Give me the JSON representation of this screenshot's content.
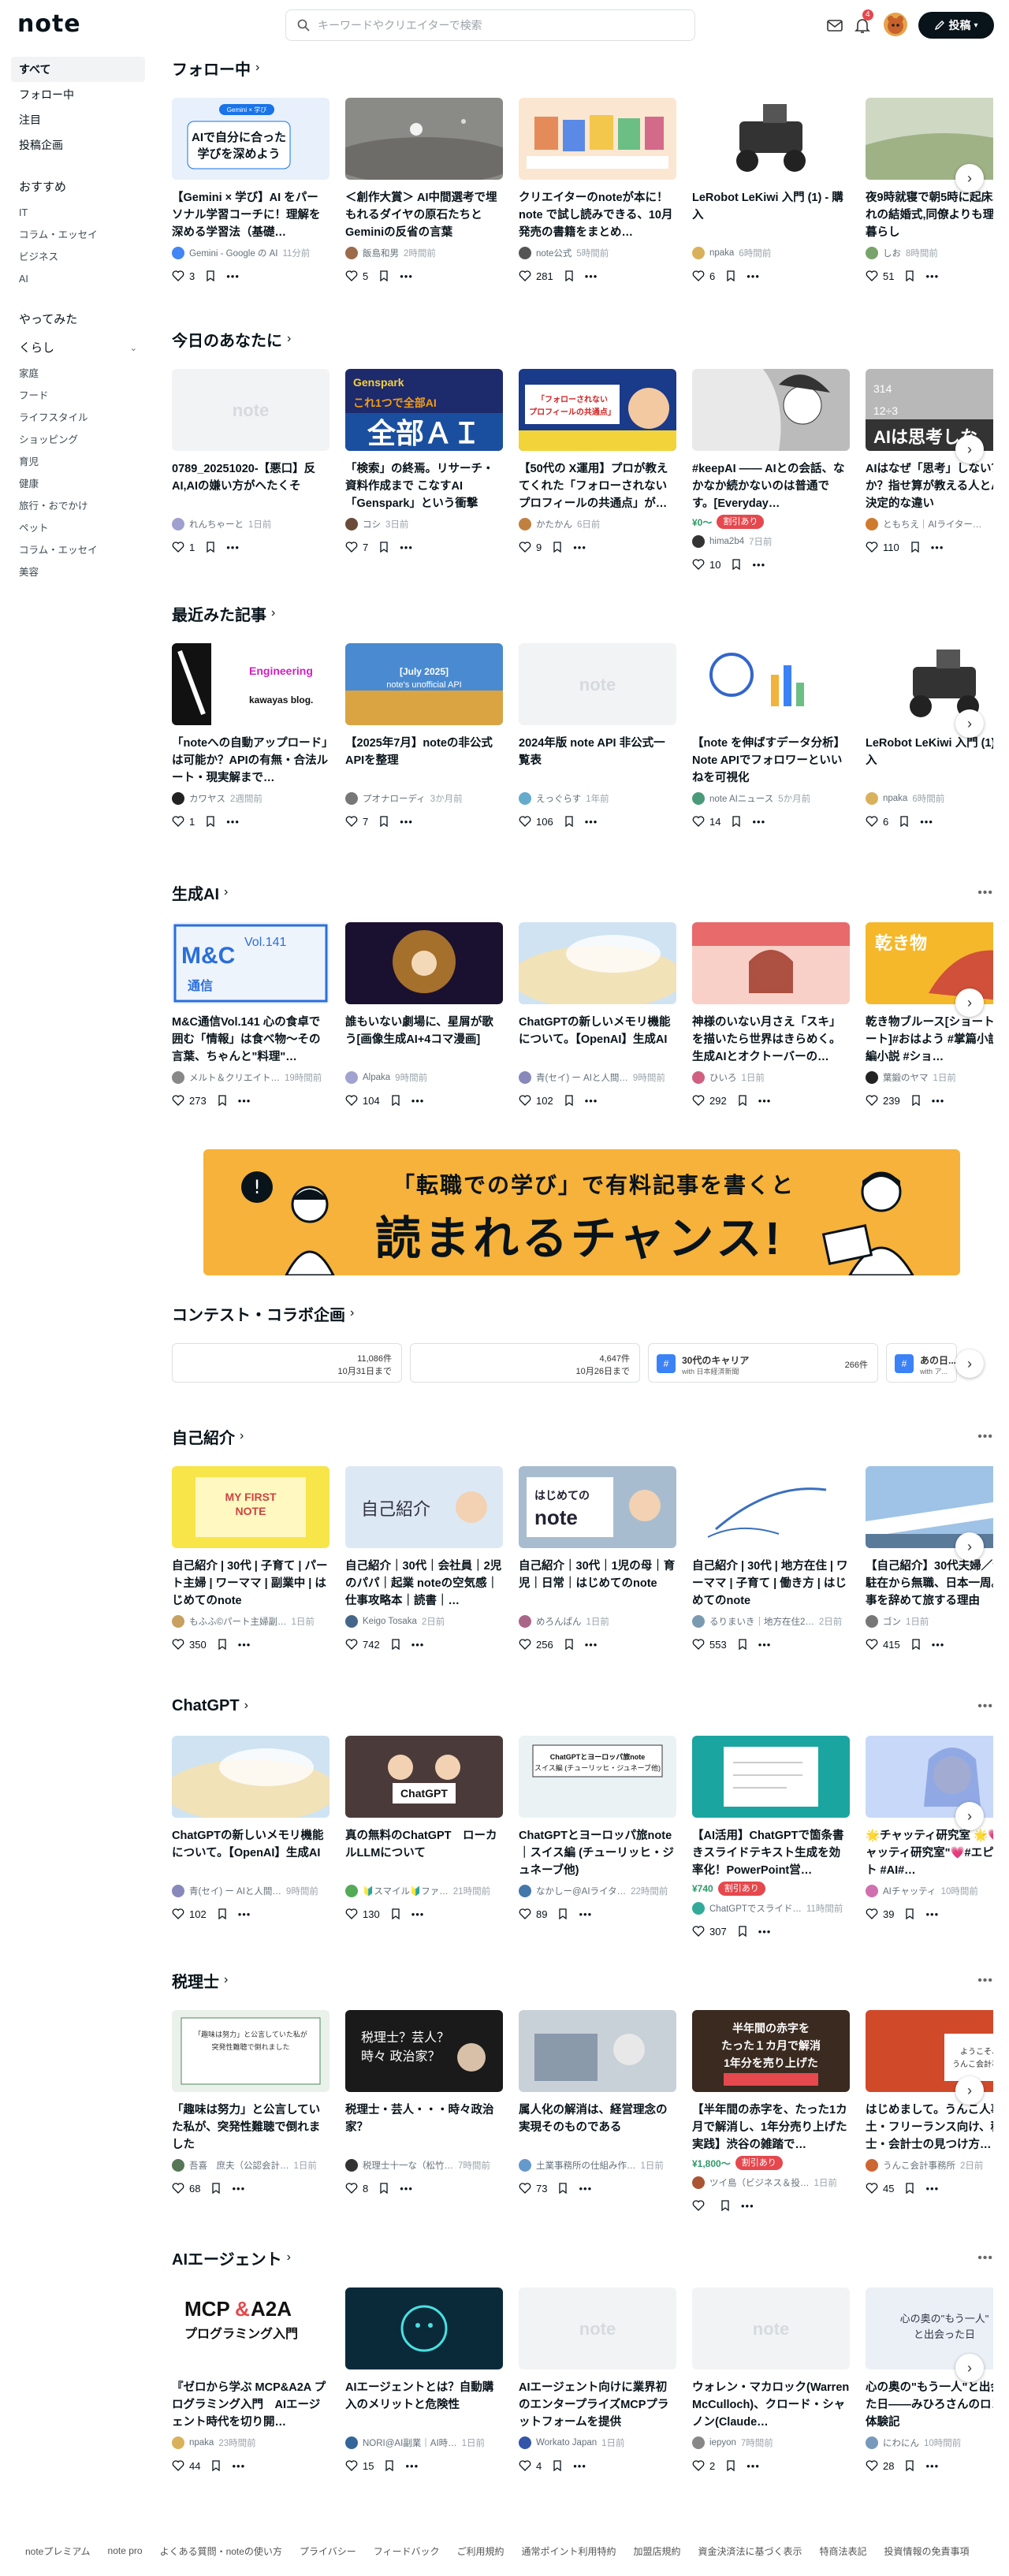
{
  "header": {
    "logo": "note",
    "search_placeholder": "キーワードやクリエイターで検索",
    "notification_count": "4",
    "post_label": "投稿"
  },
  "sidebar": {
    "top": [
      "すべて",
      "フォロー中",
      "注目",
      "投稿企画"
    ],
    "mid": [
      "おすすめ",
      "IT",
      "コラム・エッセイ",
      "ビジネス",
      "AI"
    ],
    "group1": "やってみた",
    "group2": "くらし",
    "kurashi": [
      "家庭",
      "フード",
      "ライフスタイル",
      "ショッピング",
      "育児",
      "健康",
      "旅行・おでかけ",
      "ペット",
      "コラム・エッセイ",
      "美容"
    ]
  },
  "sections": [
    {
      "title": "フォロー中",
      "cards": [
        {
          "title": "【Gemini × 学び】AI をパーソナル学習コーチに！理解を深める学習法（基礎…",
          "author": "Gemini - Google の AI",
          "time": "11分前",
          "likes": "3",
          "thumb": "gemini",
          "av": "#4285f4"
        },
        {
          "title": "＜創作大賞＞ AI中間選考で埋もれるダイヤの原石たちとGeminiの反省の言葉",
          "author": "飯島和男",
          "time": "2時間前",
          "likes": "5",
          "thumb": "stone",
          "av": "#9b6b4a"
        },
        {
          "title": "クリエイターのnoteが本に！note で試し読みできる、10月発売の書籍をまとめ…",
          "author": "note公式",
          "time": "5時間前",
          "likes": "281",
          "thumb": "books",
          "av": "#555"
        },
        {
          "title": "LeRobot LeKiwi 入門 (1) - 購入",
          "author": "npaka",
          "time": "6時間前",
          "likes": "6",
          "thumb": "robot",
          "av": "#d9b15b"
        },
        {
          "title": "夜9時就寝で朝5時に起床。憧れの結婚式,同僚よりも理想の暮らし",
          "author": "しお",
          "time": "8時間前",
          "likes": "51",
          "thumb": "field",
          "av": "#7aa36b"
        }
      ]
    },
    {
      "title": "今日のあなたに",
      "cards": [
        {
          "title": "0789_20251020-【悪口】反AI,AIの嫌い方がヘたくそ",
          "author": "れんちゃーと",
          "time": "1日前",
          "likes": "1",
          "thumb": "blank",
          "av": "#a0a0d0"
        },
        {
          "title": "「検索」の終焉。リサーチ・資料作成まで こなすAI「Genspark」という衝撃",
          "author": "コシ",
          "time": "3日前",
          "likes": "7",
          "thumb": "genspark",
          "av": "#6b4a3a"
        },
        {
          "title": "【50代の X運用】プロが教えてくれた「フォローされないプロフィールの共通点」が…",
          "author": "かたかん",
          "time": "6日前",
          "likes": "9",
          "thumb": "x50",
          "av": "#c08040"
        },
        {
          "title": "#keepAI —— AIとの会話、なかなか続かないのは普通です。[Everyday…",
          "author": "hima2b4",
          "time": "7日前",
          "likes": "10",
          "thumb": "manga",
          "av": "#333",
          "price": "¥0〜",
          "tag": "割引あり"
        },
        {
          "title": "AIはなぜ「思考」しない？か？指せ算が教える人とAIの決定的な違い",
          "author": "ともちえ｜AIライター…",
          "time": "",
          "likes": "110",
          "thumb": "math",
          "av": "#d07a30"
        }
      ]
    },
    {
      "title": "最近みた記事",
      "cards": [
        {
          "title": "「noteへの自動アップロード」は可能か？APIの有無・合法ルート・現実解まで…",
          "author": "カワヤス",
          "time": "2週間前",
          "likes": "1",
          "thumb": "kawayas",
          "av": "#222"
        },
        {
          "title": "【2025年7月】noteの非公式APIを整理",
          "author": "プオナローディ",
          "time": "3か月前",
          "likes": "7",
          "thumb": "sky",
          "av": "#777"
        },
        {
          "title": "2024年版 note API 非公式一覧表",
          "author": "えっぐらす",
          "time": "1年前",
          "likes": "106",
          "thumb": "blank",
          "av": "#66aacc"
        },
        {
          "title": "【note を伸ばすデータ分析】Note APIでフォロワーといいねを可視化",
          "author": "note AIニュース",
          "time": "5か月前",
          "likes": "14",
          "thumb": "analysis",
          "av": "#4a9a7a"
        },
        {
          "title": "LeRobot LeKiwi 入門 (1) - 購入",
          "author": "npaka",
          "time": "6時間前",
          "likes": "6",
          "thumb": "robot",
          "av": "#d9b15b"
        }
      ]
    },
    {
      "title": "生成AI",
      "cards": [
        {
          "title": "M&C通信Vol.141 心の食卓で囲む「情報」は食べ物〜その言葉、ちゃんと\"料理\"…",
          "author": "メルト＆クリエイト…",
          "time": "19時間前",
          "likes": "273",
          "thumb": "mc",
          "av": "#888"
        },
        {
          "title": "誰もいない劇場に、星屑が歌う[画像生成AI+4コマ漫画]",
          "author": "Alpaka",
          "time": "9時間前",
          "likes": "104",
          "thumb": "stars",
          "av": "#a2a2d0"
        },
        {
          "title": "ChatGPTの新しいメモリ機能について。【OpenAI】生成AI",
          "author": "青(セイ) ー AIと人間…",
          "time": "9時間前",
          "likes": "102",
          "thumb": "rainbow",
          "av": "#8888bb"
        },
        {
          "title": "神様のいない月さえ「スキ」を描いたら世界はきらめく。生成AIとオクトーバーの…",
          "author": "ひいろ",
          "time": "1日前",
          "likes": "292",
          "thumb": "girl",
          "av": "#d06080"
        },
        {
          "title": "乾き物ブルース[ショートショート]#おはよう #掌篇小説 #短編小説 #ショ…",
          "author": "葉鍛のヤマ",
          "time": "1日前",
          "likes": "239",
          "thumb": "dragon",
          "av": "#222"
        }
      ]
    }
  ],
  "banner": {
    "line1": "「転職での学び」で有料記事を書くと",
    "line2": "読まれるチャンス!"
  },
  "contest": {
    "title": "コンテスト・コラボ企画",
    "items": [
      {
        "count": "11,086件",
        "deadline": "10月31日まで"
      },
      {
        "count": "4,647件",
        "deadline": "10月26日まで"
      },
      {
        "name": "30代のキャリア",
        "sponsor": "with 日本経済新聞",
        "count": "266件"
      },
      {
        "name": "あの日...",
        "sponsor": "with ア..."
      }
    ]
  },
  "sections2": [
    {
      "title": "自己紹介",
      "cards": [
        {
          "title": "自己紹介 | 30代 | 子育て | パート主婦 | ワーママ | 副業中 | はじめてのnote",
          "author": "もふふ©パート主婦副…",
          "time": "1日前",
          "likes": "350",
          "thumb": "firstnote",
          "av": "#c8a060"
        },
        {
          "title": "自己紹介｜30代｜会社員｜2児のパパ｜起業 noteの空気感｜仕事攻略本｜読書｜…",
          "author": "Keigo Tosaka",
          "time": "2日前",
          "likes": "742",
          "thumb": "jiko",
          "av": "#446688"
        },
        {
          "title": "自己紹介｜30代｜1児の母｜育児｜日常｜はじめてのnote",
          "author": "めろんぱん",
          "time": "1日前",
          "likes": "256",
          "thumb": "hajimete",
          "av": "#aa6688"
        },
        {
          "title": "自己紹介 | 30代 | 地方在住 | ワーママ | 子育て | 働き方 | はじめてのnote",
          "author": "るりまいき｜地方在住2…",
          "time": "2日前",
          "likes": "553",
          "thumb": "pen",
          "av": "#7a9ab0"
        },
        {
          "title": "【自己紹介】30代夫婦／海外駐在から無職、日本一周。仕事を辞めて旅する理由",
          "author": "ゴン",
          "time": "1日前",
          "likes": "415",
          "thumb": "plane",
          "av": "#777"
        }
      ]
    },
    {
      "title": "ChatGPT",
      "cards": [
        {
          "title": "ChatGPTの新しいメモリ機能について。【OpenAI】生成AI",
          "author": "青(セイ) ー AIと人間…",
          "time": "9時間前",
          "likes": "102",
          "thumb": "rainbow",
          "av": "#8888bb"
        },
        {
          "title": "真の無料のChatGPT　ローカルLLMについて",
          "author": "🔰スマイル🔰ファ…",
          "time": "21時間前",
          "likes": "130",
          "thumb": "couple",
          "av": "#55aa55"
        },
        {
          "title": "ChatGPTとヨーロッパ旅note｜スイス編 (チューリッヒ・ジュネーブ他)",
          "author": "なかしー@AIライタ…",
          "time": "22時間前",
          "likes": "89",
          "thumb": "swiss",
          "av": "#4477aa"
        },
        {
          "title": "【AI活用】ChatGPTで箇条書きスライドテキスト生成を効率化！PowerPoint営…",
          "author": "ChatGPTでスライド…",
          "time": "11時間前",
          "likes": "307",
          "thumb": "slides",
          "av": "#33aa99",
          "price": "¥740",
          "tag": "割引あり"
        },
        {
          "title": "🌟チャッティ研究室 🌟💗 \"チャッティ研究室\"💗#エピアート #AI#…",
          "author": "AIチャッティ",
          "time": "10時間前",
          "likes": "39",
          "thumb": "anime2",
          "av": "#d070b0"
        }
      ]
    },
    {
      "title": "税理士",
      "cards": [
        {
          "title": "「趣味は努力」と公言していた私が、突発性難聴で倒れました",
          "author": "吾喜　庶夫（公認会計…",
          "time": "1日前",
          "likes": "68",
          "thumb": "tax1",
          "av": "#557755"
        },
        {
          "title": "税理士・芸人・・・時々政治家？",
          "author": "税理士十一な（松竹…",
          "time": "7時間前",
          "likes": "8",
          "thumb": "tax2",
          "av": "#333"
        },
        {
          "title": "属人化の解消は、経営理念の実現そのものである",
          "author": "土業事務所の仕組み作…",
          "time": "1日前",
          "likes": "73",
          "thumb": "office",
          "av": "#6699cc"
        },
        {
          "title": "【半年間の赤字を、たった1カ月で解消し、1年分売り上げた実践】渋谷の雑踏で…",
          "author": "ツイ島（ビジネス＆投…",
          "time": "1日前",
          "likes": "",
          "thumb": "red",
          "av": "#aa5533",
          "price": "¥1,800〜",
          "tag": "割引あり"
        },
        {
          "title": "はじめまして。うんこ人事土・フリーランス向け、税理士・会計士の見つけ方…",
          "author": "うんこ会計事務所",
          "time": "2日前",
          "likes": "45",
          "thumb": "unko",
          "av": "#cc6633"
        }
      ]
    },
    {
      "title": "AIエージェント",
      "cards": [
        {
          "title": "『ゼロから学ぶ MCP&A2A プログラミング入門　AIエージェント時代を切り開…",
          "author": "npaka",
          "time": "23時間前",
          "likes": "44",
          "thumb": "mcp",
          "av": "#d9b15b"
        },
        {
          "title": "AIエージェントとは？自動購入のメリットと危険性",
          "author": "NORI@AI副業｜AI時…",
          "time": "1日前",
          "likes": "15",
          "thumb": "aiagent",
          "av": "#336699"
        },
        {
          "title": "AIエージェント向けに業界初のエンタープライズMCPプラットフォームを提供",
          "author": "Workato Japan",
          "time": "1日前",
          "likes": "4",
          "thumb": "blank",
          "av": "#3355aa"
        },
        {
          "title": "ウォレン・マカロック(Warren McCulloch)、クロード・シャノン(Claude…",
          "author": "iepyon",
          "time": "7時間前",
          "likes": "2",
          "thumb": "blank",
          "av": "#888"
        },
        {
          "title": "心の奥の\"もう一人\"と出会った日——みひろさんのロング体験記",
          "author": "にわにん",
          "time": "10時間前",
          "likes": "28",
          "thumb": "heart",
          "av": "#7799bb"
        }
      ]
    }
  ],
  "footer": [
    "noteプレミアム",
    "note pro",
    "よくある質問・noteの使い方",
    "プライバシー",
    "フィードバック",
    "ご利用規約",
    "通常ポイント利用特約",
    "加盟店規約",
    "資金決済法に基づく表示",
    "特商法表記",
    "投資情報の免責事項"
  ]
}
